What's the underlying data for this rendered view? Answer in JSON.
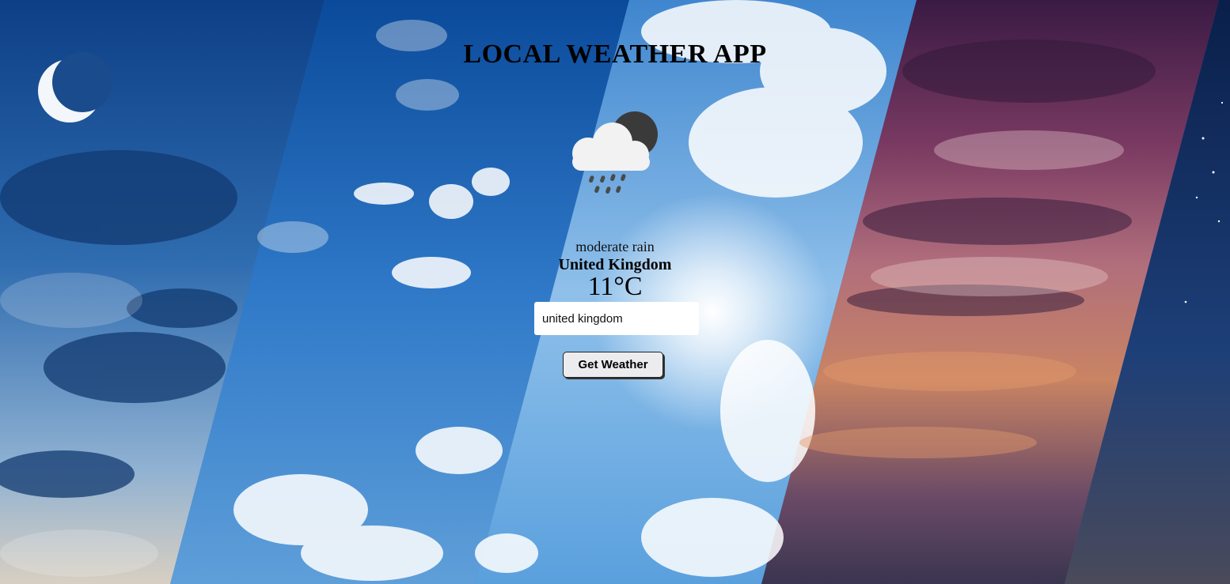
{
  "app": {
    "title": "LOCAL WEATHER APP"
  },
  "weather": {
    "icon": "rain-cloud-night-icon",
    "description": "moderate rain",
    "location": "United Kingdom",
    "temperature": "11°C"
  },
  "search": {
    "value": "united kingdom",
    "button_label": "Get Weather"
  },
  "colors": {
    "title_text": "#000000",
    "button_bg": "#ececef",
    "input_bg": "#ffffff"
  }
}
